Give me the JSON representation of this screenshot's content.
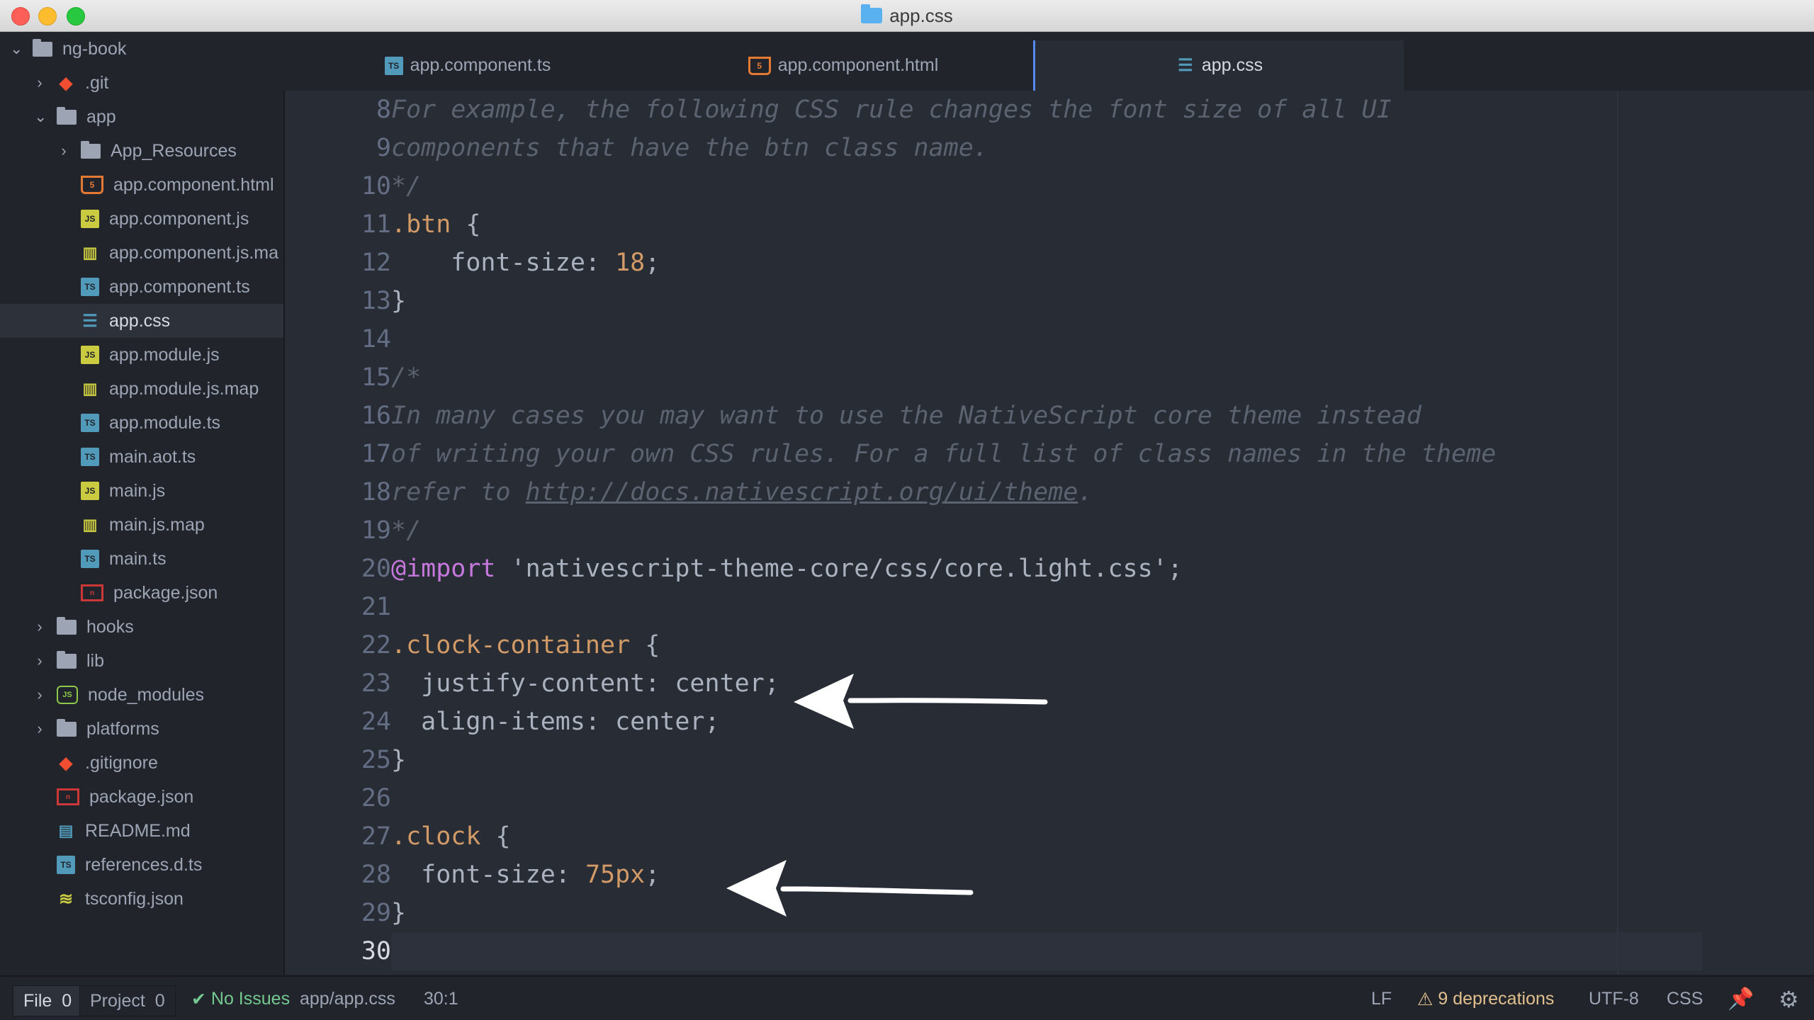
{
  "window": {
    "title": "app.css"
  },
  "sidebar": {
    "root": "ng-book",
    "items": [
      {
        "label": ".git",
        "icon": "git-icon"
      },
      {
        "label": "app",
        "icon": "folder-icon"
      },
      {
        "label": "App_Resources",
        "icon": "folder-icon"
      },
      {
        "label": "app.component.html",
        "icon": "html5-icon"
      },
      {
        "label": "app.component.js",
        "icon": "javascript-icon"
      },
      {
        "label": "app.component.js.ma",
        "icon": "map-icon"
      },
      {
        "label": "app.component.ts",
        "icon": "typescript-icon"
      },
      {
        "label": "app.css",
        "icon": "css3-icon"
      },
      {
        "label": "app.module.js",
        "icon": "javascript-icon"
      },
      {
        "label": "app.module.js.map",
        "icon": "map-icon"
      },
      {
        "label": "app.module.ts",
        "icon": "typescript-icon"
      },
      {
        "label": "main.aot.ts",
        "icon": "typescript-icon"
      },
      {
        "label": "main.js",
        "icon": "javascript-icon"
      },
      {
        "label": "main.js.map",
        "icon": "map-icon"
      },
      {
        "label": "main.ts",
        "icon": "typescript-icon"
      },
      {
        "label": "package.json",
        "icon": "npm-icon"
      },
      {
        "label": "hooks",
        "icon": "folder-icon"
      },
      {
        "label": "lib",
        "icon": "folder-icon"
      },
      {
        "label": "node_modules",
        "icon": "nodejs-icon"
      },
      {
        "label": "platforms",
        "icon": "folder-icon"
      },
      {
        "label": ".gitignore",
        "icon": "git-icon"
      },
      {
        "label": "package.json",
        "icon": "npm-icon"
      },
      {
        "label": "README.md",
        "icon": "markdown-icon"
      },
      {
        "label": "references.d.ts",
        "icon": "typescript-icon"
      },
      {
        "label": "tsconfig.json",
        "icon": "config-icon"
      }
    ]
  },
  "tabs": [
    {
      "label": "app.component.ts",
      "icon": "typescript-icon"
    },
    {
      "label": "app.component.html",
      "icon": "html5-icon"
    },
    {
      "label": "app.css",
      "icon": "css3-icon",
      "active": true
    }
  ],
  "editor": {
    "line_numbers": [
      "8",
      "9",
      "10",
      "11",
      "12",
      "13",
      "14",
      "15",
      "16",
      "17",
      "18",
      "19",
      "20",
      "21",
      "22",
      "23",
      "24",
      "25",
      "26",
      "27",
      "28",
      "29",
      "30"
    ],
    "lines": {
      "l8": "For example, the following CSS rule changes the font size of all UI",
      "l9": "components that have the btn class name.",
      "l10": "*/",
      "l11_sel": ".btn",
      "l11_rest": " {",
      "l12_prop": "    font-size: ",
      "l12_val": "18",
      "l12_end": ";",
      "l13": "}",
      "l15": "/*",
      "l16": "In many cases you may want to use the NativeScript core theme instead",
      "l17": "of writing your own CSS rules. For a full list of class names in the theme",
      "l18_pre": "refer to ",
      "l18_url": "http://docs.nativescript.org/ui/theme",
      "l18_post": ".",
      "l19": "*/",
      "l20_kw": "@import",
      "l20_str": " 'nativescript-theme-core/css/core.light.css';",
      "l22_sel": ".clock-container",
      "l22_rest": " {",
      "l23": "  justify-content: center;",
      "l24": "  align-items: center;",
      "l25": "}",
      "l27_sel": ".clock",
      "l27_rest": " {",
      "l28_prop": "  font-size: ",
      "l28_val": "75px",
      "l28_end": ";",
      "l29": "}"
    }
  },
  "status": {
    "file_label": "File",
    "file_count": "0",
    "project_label": "Project",
    "project_count": "0",
    "issues": "No Issues",
    "path": "app/app.css",
    "cursor": "30:1",
    "line_ending": "LF",
    "deprecations": "9 deprecations",
    "encoding": "UTF-8",
    "grammar": "CSS"
  },
  "colors": {
    "accent": "#568af2",
    "selector": "#d19a66",
    "keyword": "#c678dd",
    "comment": "#5c6370"
  }
}
